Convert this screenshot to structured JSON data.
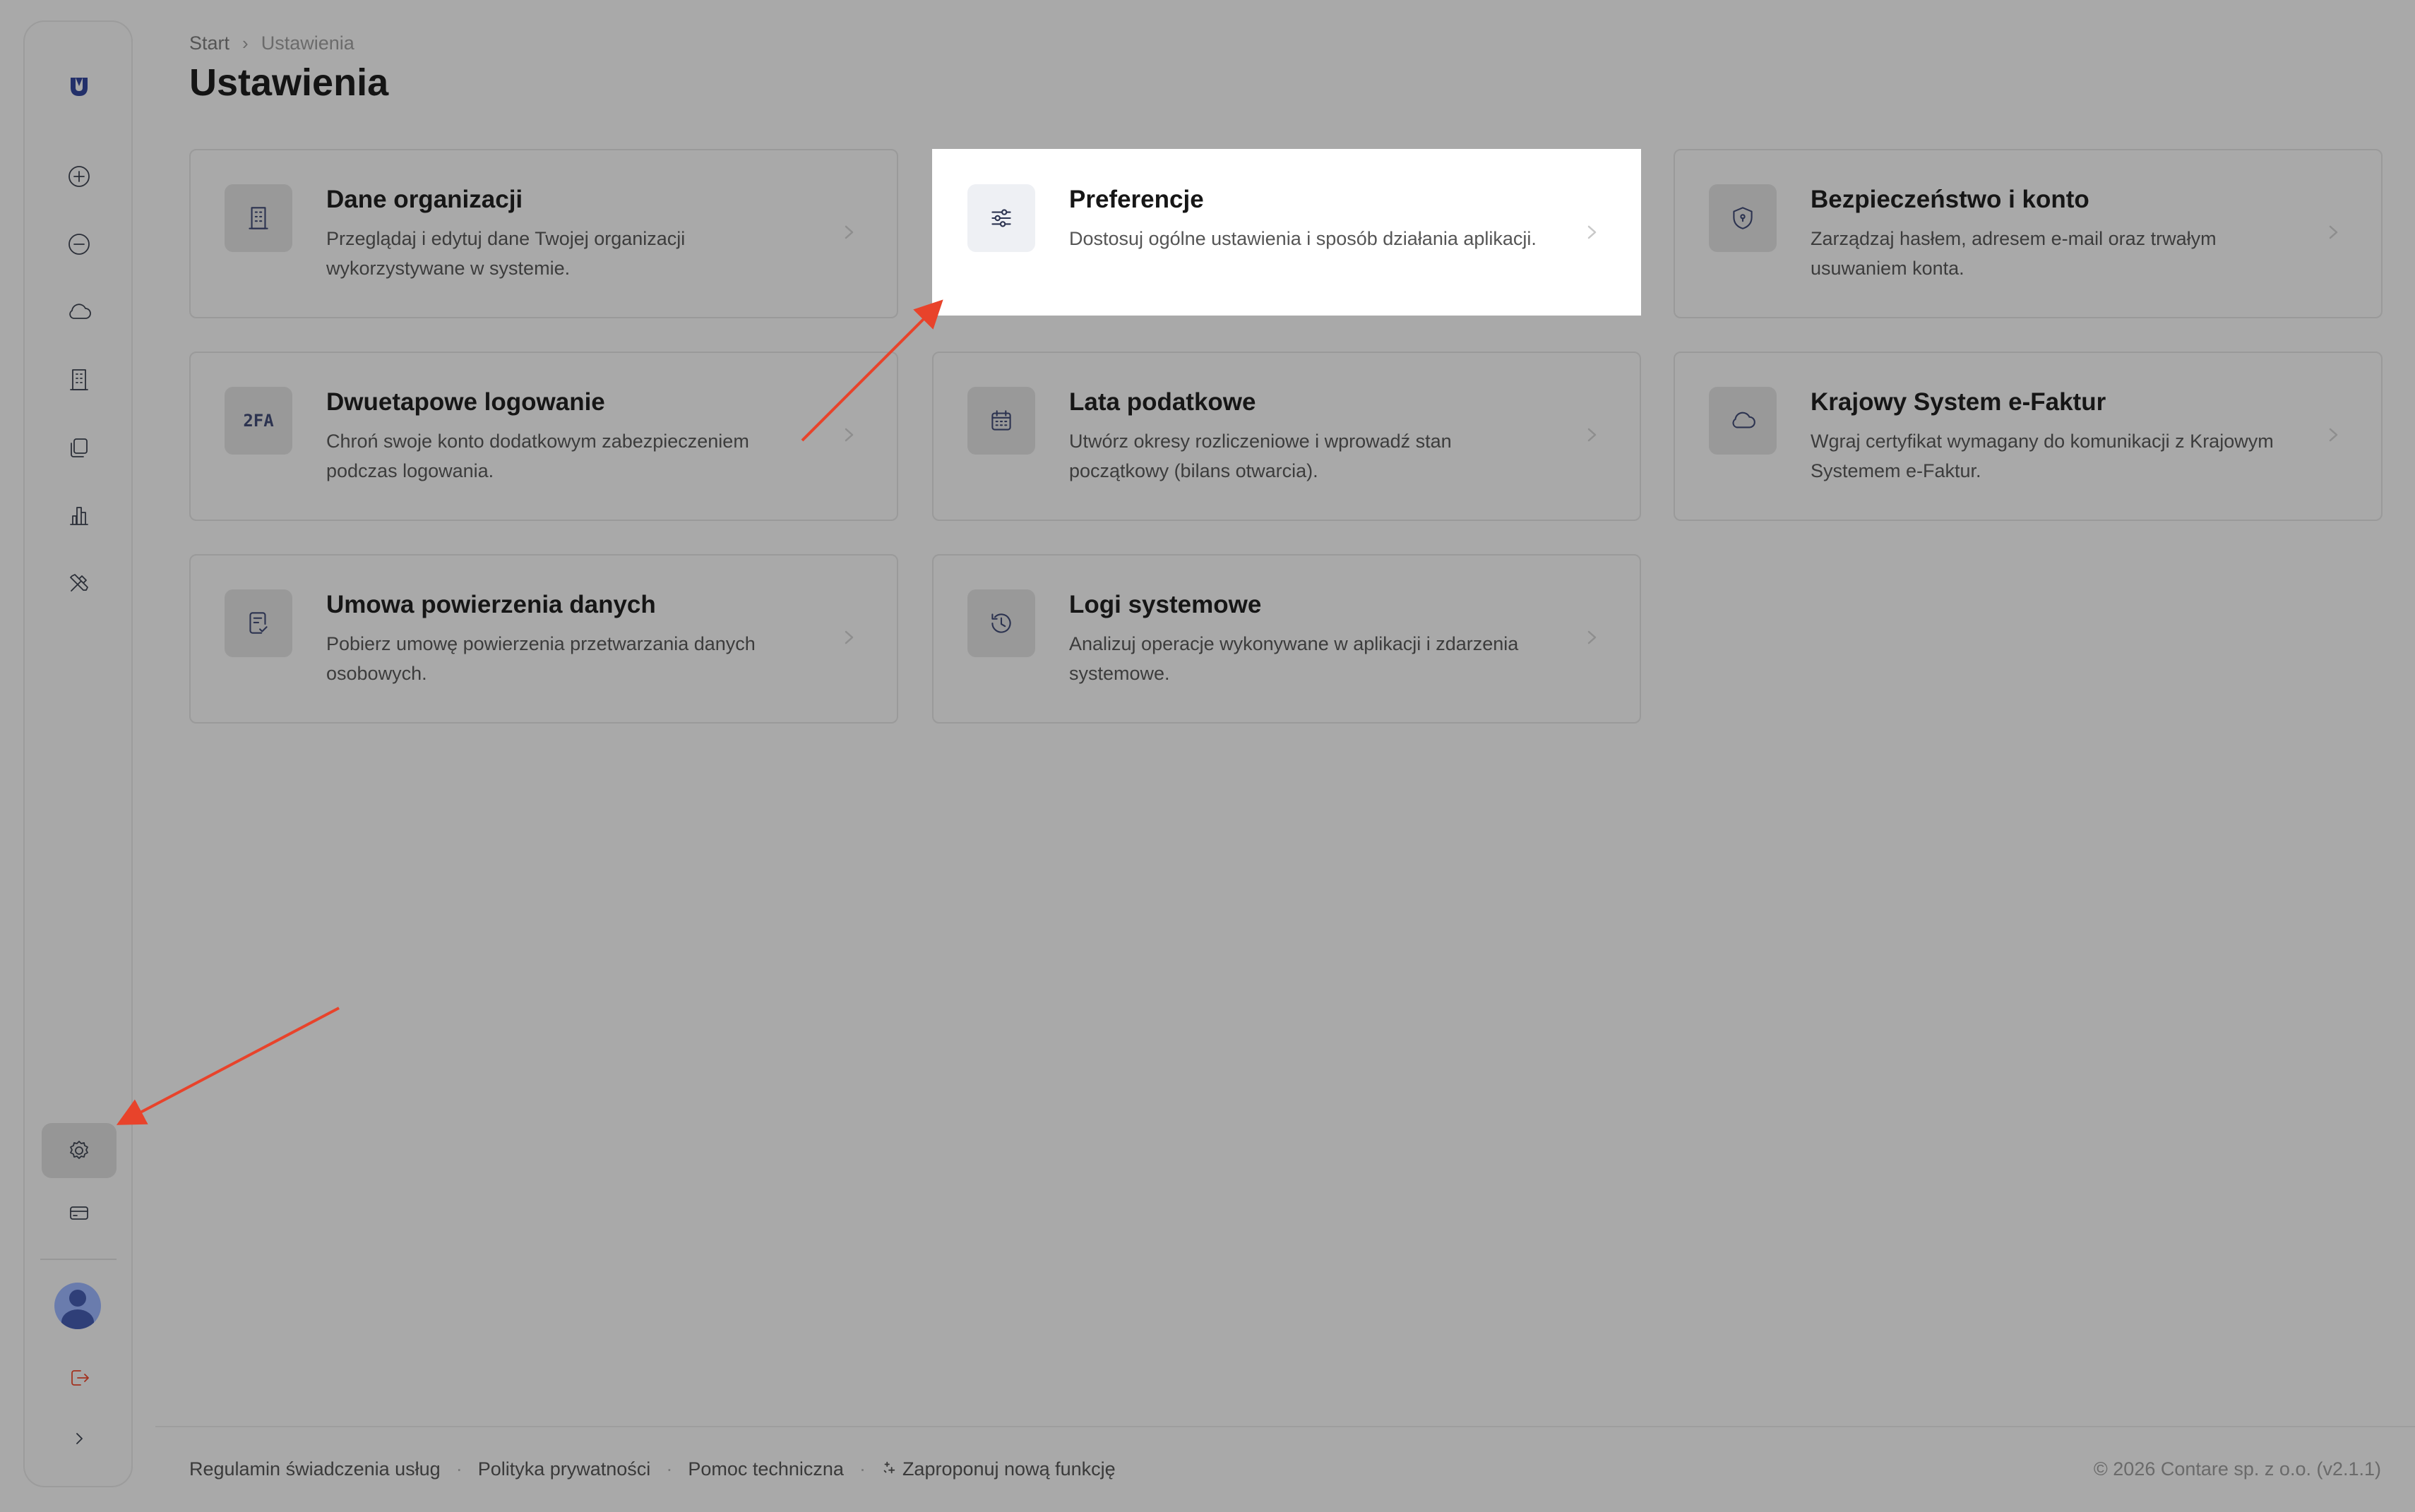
{
  "breadcrumb": {
    "home": "Start",
    "separator": "›",
    "current": "Ustawienia"
  },
  "page_title": "Ustawienia",
  "sidebar": {
    "logo_icon": "brand-logo-icon",
    "items": [
      {
        "icon": "plus-circle-icon"
      },
      {
        "icon": "minus-circle-icon"
      },
      {
        "icon": "cloud-icon"
      },
      {
        "icon": "building-icon"
      },
      {
        "icon": "documents-icon"
      },
      {
        "icon": "bar-chart-icon"
      },
      {
        "icon": "tools-icon"
      }
    ],
    "bottom_items": [
      {
        "icon": "gear-icon",
        "active": true
      },
      {
        "icon": "credit-card-icon"
      },
      {
        "icon": "avatar"
      },
      {
        "icon": "logout-icon"
      },
      {
        "icon": "chevron-right-icon"
      }
    ]
  },
  "cards": [
    {
      "title": "Dane organizacji",
      "desc": "Przeglądaj i edytuj dane Twojej organizacji wykorzystywane w systemie.",
      "icon": "building-icon"
    },
    {
      "title": "Preferencje",
      "desc": "Dostosuj ogólne ustawienia i sposób działania aplikacji.",
      "icon": "sliders-icon"
    },
    {
      "title": "Bezpieczeństwo i konto",
      "desc": "Zarządzaj hasłem, adresem e-mail oraz trwałym usuwaniem konta.",
      "icon": "shield-icon"
    },
    {
      "title": "Dwuetapowe logowanie",
      "desc": "Chroń swoje konto dodatkowym zabezpieczeniem podczas logowania.",
      "icon": "2fa-icon",
      "icon_text": "2FA"
    },
    {
      "title": "Lata podatkowe",
      "desc": "Utwórz okresy rozliczeniowe i wprowadź stan początkowy (bilans otwarcia).",
      "icon": "calendar-icon"
    },
    {
      "title": "Krajowy System e-Faktur",
      "desc": "Wgraj certyfikat wymagany do komunikacji z Krajowym Systemem e-Faktur.",
      "icon": "cloud-icon"
    },
    {
      "title": "Umowa powierzenia danych",
      "desc": "Pobierz umowę powierzenia przetwarzania danych osobowych.",
      "icon": "document-check-icon"
    },
    {
      "title": "Logi systemowe",
      "desc": "Analizuj operacje wykonywane w aplikacji i zdarzenia systemowe.",
      "icon": "history-icon"
    }
  ],
  "footer": {
    "links": [
      "Regulamin świadczenia usług",
      "Polityka prywatności",
      "Pomoc techniczna",
      "Zaproponuj nową funkcję"
    ],
    "separator": "·",
    "copyright": "© 2026 Contare sp. z o.o. (v2.1.1)"
  },
  "colors": {
    "overlay_bg": "#a9a9a9",
    "highlight_card": "#ffffff",
    "annotation_arrow": "#e8432b",
    "icon_stroke": "#2c3350"
  }
}
